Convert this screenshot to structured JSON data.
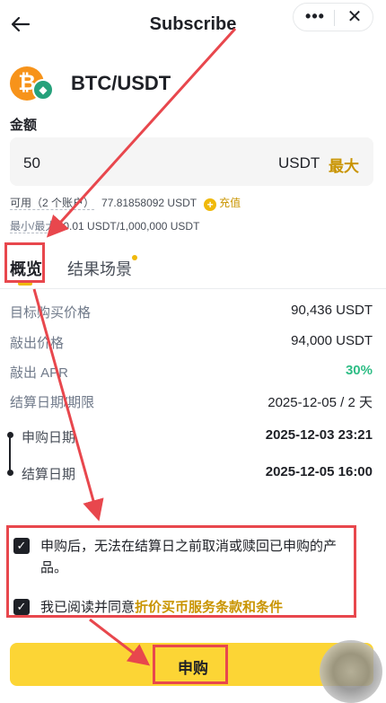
{
  "header": {
    "back_icon": "arrow-left-icon",
    "title": "Subscribe",
    "more_icon": "more-dots-icon",
    "more_glyph": "•••",
    "close_icon": "close-icon",
    "close_glyph": "✕"
  },
  "coin": {
    "pair": "BTC/USDT",
    "base_glyph": "₿",
    "quote_glyph": "◆",
    "base_color": "#f7931a",
    "quote_color": "#26a17b"
  },
  "amount": {
    "label": "金额",
    "value": "50",
    "unit": "USDT",
    "max_label": "最大"
  },
  "available": {
    "label": "可用（2 个账户）",
    "value": "77.81858092 USDT",
    "topup_label": "充值"
  },
  "minmax": {
    "label": "最小/最大",
    "value": "0.01 USDT/1,000,000 USDT"
  },
  "tabs": [
    {
      "label": "概览",
      "active": true
    },
    {
      "label": "结果场景",
      "active": false
    }
  ],
  "details": [
    {
      "label": "目标购买价格",
      "value": "90,436 USDT"
    },
    {
      "label": "敲出价格",
      "value": "94,000 USDT"
    },
    {
      "label": "敲出 APR",
      "value": "30%"
    },
    {
      "label": "结算日期/期限",
      "value": "2025-12-05 / 2 天"
    }
  ],
  "timeline": [
    {
      "label": "申购日期",
      "value": "2025-12-03 23:21"
    },
    {
      "label": "结算日期",
      "value": "2025-12-05 16:00"
    }
  ],
  "agreements": {
    "item1": "申购后，无法在结算日之前取消或赎回已申购的产品。",
    "item2_prefix": "我已阅读并同意",
    "item2_link": "折价买币服务条款和条件",
    "checked_glyph": "✓"
  },
  "subscribe_button": "申购",
  "colors": {
    "accent": "#f0b90b",
    "button": "#fcd535",
    "link": "#c99400",
    "positive": "#2ebd85",
    "annotation": "#e8474d"
  }
}
